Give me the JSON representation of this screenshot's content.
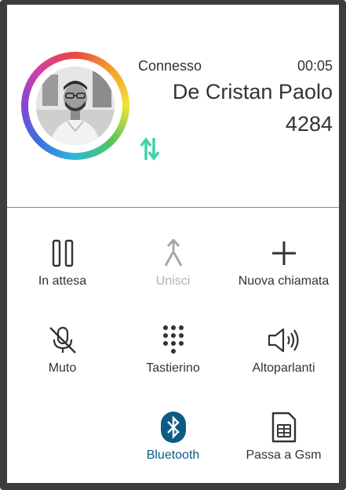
{
  "call": {
    "status": "Connesso",
    "timer": "00:05",
    "contact_name": "De Cristan Paolo",
    "contact_number": "4284"
  },
  "icons": {
    "avatar": "contact-photo",
    "transfer": "transfer-arrows-icon"
  },
  "colors": {
    "accent_green": "#3ed2a8",
    "bluetooth_blue": "#0e5a86",
    "text": "#333333",
    "disabled": "#b0b0b0"
  },
  "actions": [
    {
      "id": "hold",
      "label": "In attesa",
      "icon": "pause-icon",
      "state": "normal"
    },
    {
      "id": "merge",
      "label": "Unisci",
      "icon": "merge-icon",
      "state": "disabled"
    },
    {
      "id": "new-call",
      "label": "Nuova chiamata",
      "icon": "plus-icon",
      "state": "normal"
    },
    {
      "id": "mute",
      "label": "Muto",
      "icon": "mic-off-icon",
      "state": "normal"
    },
    {
      "id": "keypad",
      "label": "Tastierino",
      "icon": "dialpad-icon",
      "state": "normal"
    },
    {
      "id": "speaker",
      "label": "Altoparlanti",
      "icon": "speaker-icon",
      "state": "normal"
    },
    {
      "id": "bluetooth",
      "label": "Bluetooth",
      "icon": "bluetooth-icon",
      "state": "active"
    },
    {
      "id": "gsm",
      "label": "Passa a Gsm",
      "icon": "sim-card-icon",
      "state": "normal"
    }
  ]
}
